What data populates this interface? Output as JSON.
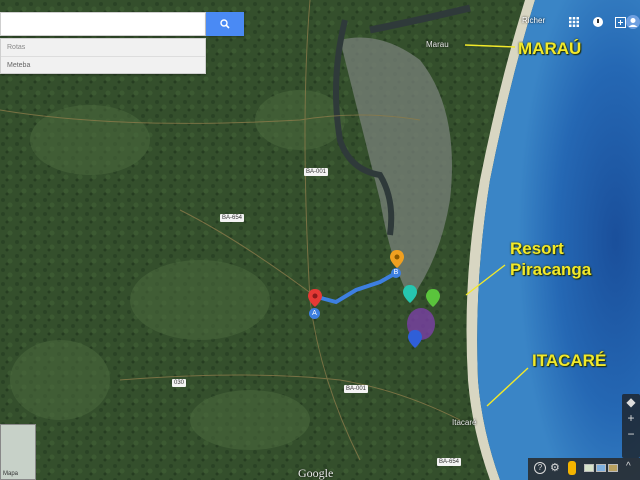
{
  "search": {
    "value": "",
    "route_from": "Rotas",
    "route_to": "Meteba"
  },
  "topbar": {
    "user": "Richer",
    "icons": [
      "apps-icon",
      "notifications-icon",
      "share-icon",
      "account-icon"
    ]
  },
  "annotations": {
    "marau": "MARAÚ",
    "resort": "Resort\nPiracanga",
    "itacare": "ITACARÉ"
  },
  "map_places": {
    "marau_small": "Marau",
    "itacare_small": "Itacaré"
  },
  "roads": [
    "BA-001",
    "BA-654",
    "BR-030",
    "BA-001",
    "BA-654",
    "030"
  ],
  "markers": {
    "start": "A",
    "end": "B"
  },
  "colors": {
    "label": "#f2e92a",
    "route": "#3d7fe0",
    "ocean": "#1f5fa8",
    "forest": "#2f4a2a"
  },
  "thumb_label": "Mapa",
  "logo": "Google"
}
